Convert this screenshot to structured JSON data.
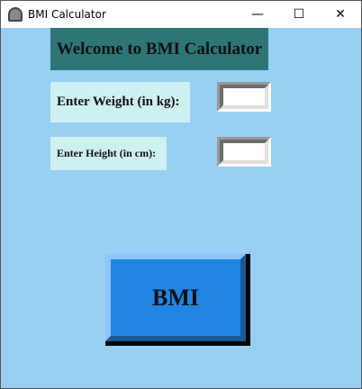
{
  "window": {
    "title": "BMI Calculator",
    "minimize": "—",
    "maximize": "☐",
    "close": "✕"
  },
  "header": {
    "title": "Welcome to BMI Calculator"
  },
  "weight": {
    "label": "Enter Weight (in kg):",
    "value": ""
  },
  "height": {
    "label": "Enter Height (in cm):",
    "value": ""
  },
  "button": {
    "label": "BMI"
  },
  "colors": {
    "background": "#99cff3",
    "header": "#2e7578",
    "label": "#cdf0f0",
    "button": "#2185e4"
  }
}
